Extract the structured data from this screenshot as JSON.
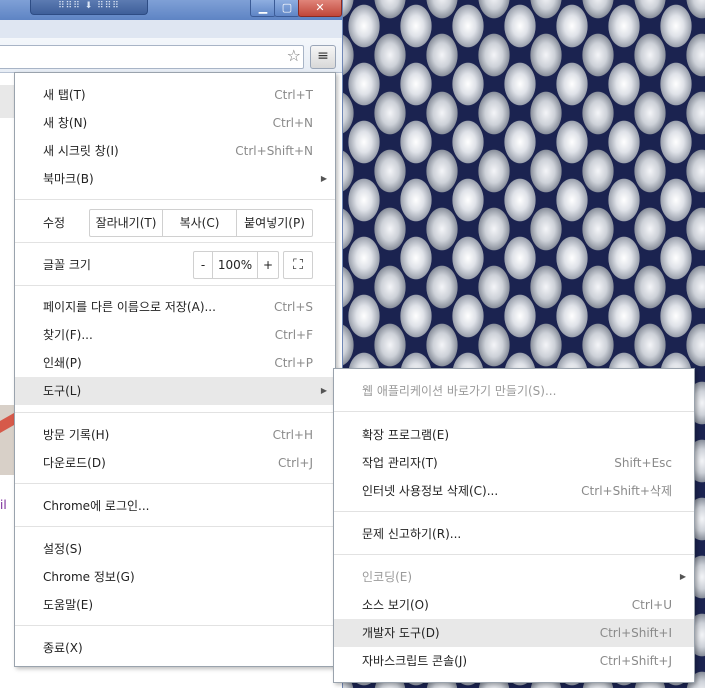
{
  "window": {
    "fullscreen_handle": "⠿⠿⠿ ⬇ ⠿⠿⠿",
    "min_glyph": "▁",
    "max_glyph": "▢",
    "close_glyph": "✕"
  },
  "toolbar": {
    "star_glyph": "☆",
    "menu_glyph": "≡"
  },
  "page": {
    "fragment_text": "il"
  },
  "menu": {
    "new_tab": {
      "label": "새 탭(T)",
      "shortcut": "Ctrl+T"
    },
    "new_window": {
      "label": "새 창(N)",
      "shortcut": "Ctrl+N"
    },
    "incognito": {
      "label": "새 시크릿 창(I)",
      "shortcut": "Ctrl+Shift+N"
    },
    "bookmarks": {
      "label": "북마크(B)",
      "arrow": "▶"
    },
    "edit": {
      "label": "수정",
      "cut": "잘라내기(T)",
      "copy": "복사(C)",
      "paste": "붙여넣기(P)"
    },
    "zoom": {
      "label": "글꼴 크기",
      "minus": "-",
      "value": "100%",
      "plus": "+",
      "fullscreen": "⛶"
    },
    "save_as": {
      "label": "페이지를 다른 이름으로 저장(A)...",
      "shortcut": "Ctrl+S"
    },
    "find": {
      "label": "찾기(F)...",
      "shortcut": "Ctrl+F"
    },
    "print": {
      "label": "인쇄(P)",
      "shortcut": "Ctrl+P"
    },
    "tools": {
      "label": "도구(L)",
      "arrow": "▶"
    },
    "history": {
      "label": "방문 기록(H)",
      "shortcut": "Ctrl+H"
    },
    "downloads": {
      "label": "다운로드(D)",
      "shortcut": "Ctrl+J"
    },
    "signin": {
      "label": "Chrome에 로그인..."
    },
    "settings": {
      "label": "설정(S)"
    },
    "about": {
      "label": "Chrome 정보(G)"
    },
    "help": {
      "label": "도움말(E)"
    },
    "exit": {
      "label": "종료(X)"
    }
  },
  "tools_submenu": {
    "create_shortcuts": {
      "label": "웹 애플리케이션 바로가기 만들기(S)..."
    },
    "extensions": {
      "label": "확장 프로그램(E)"
    },
    "task_manager": {
      "label": "작업 관리자(T)",
      "shortcut": "Shift+Esc"
    },
    "clear_data": {
      "label": "인터넷 사용정보 삭제(C)...",
      "shortcut": "Ctrl+Shift+삭제"
    },
    "report_issue": {
      "label": "문제 신고하기(R)..."
    },
    "encoding": {
      "label": "인코딩(E)",
      "arrow": "▶"
    },
    "view_source": {
      "label": "소스 보기(O)",
      "shortcut": "Ctrl+U"
    },
    "dev_tools": {
      "label": "개발자 도구(D)",
      "shortcut": "Ctrl+Shift+I"
    },
    "js_console": {
      "label": "자바스크립트 콘솔(J)",
      "shortcut": "Ctrl+Shift+J"
    }
  }
}
